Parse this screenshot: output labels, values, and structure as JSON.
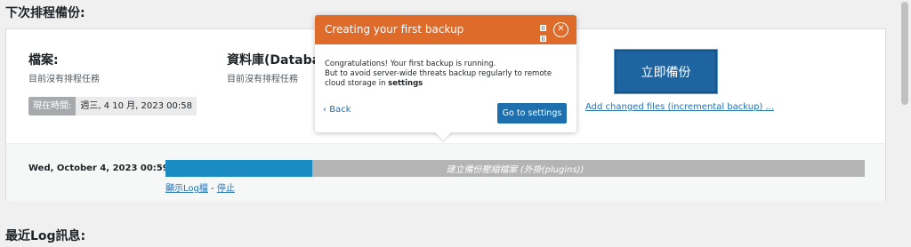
{
  "sections": {
    "next_scheduled": "下次排程備份:",
    "recent_log": "最近Log訊息:"
  },
  "files": {
    "title": "檔案:",
    "status": "目前沒有排程任務"
  },
  "database": {
    "title": "資料庫(Databa",
    "status": "目前沒有排程任務"
  },
  "current_time": {
    "label": "現在時間:",
    "value": "週三, 4 10 月, 2023 00:58"
  },
  "backup_button": {
    "label": "立即備份"
  },
  "incremental_link": "Add changed files (incremental backup) ...",
  "progress": {
    "date": "Wed, October 4, 2023 00:59",
    "percent": 21,
    "status_text": "建立備份壓縮檔案 (外掛(plugins))",
    "show_log": "顯示Log檔",
    "separator": " - ",
    "stop": "停止"
  },
  "popup": {
    "title": "Creating your first backup",
    "line1": "Congratulations! Your first backup is running.",
    "line2": "But to avoid server-wide threats backup regularly to remote cloud storage in",
    "line2_bold": "settings",
    "back": "Back",
    "go_button": "Go to settings",
    "close_icon": "close-icon",
    "back_icon": "chevron-left-icon"
  },
  "colors": {
    "popup_header": "#de6b2a",
    "backup_button": "#1e64a0",
    "progress_fill": "#1b8bc4",
    "progress_track": "#b4b4b4",
    "link": "#2271b1"
  }
}
